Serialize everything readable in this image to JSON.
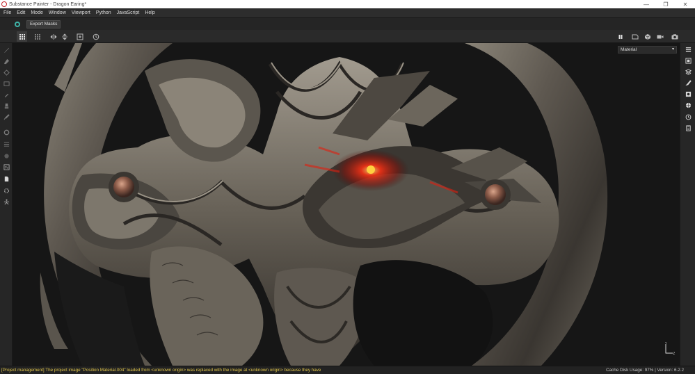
{
  "window": {
    "title": "Substance Painter - Dragon Earing*",
    "controls": [
      "minimize",
      "restore",
      "close"
    ]
  },
  "menu": [
    "File",
    "Edit",
    "Mode",
    "Window",
    "Viewport",
    "Python",
    "JavaScript",
    "Help"
  ],
  "shelf": {
    "plugin_icon": "export-masks-plugin-icon",
    "export_button_label": "Export Masks"
  },
  "toolbar": {
    "left_icons": [
      "grid-icon",
      "grid-dots-icon",
      "symmetry-x-icon",
      "symmetry-y-icon",
      "add-frame-icon",
      "history-icon"
    ],
    "right_icons": [
      "pause-icon",
      "camera-frame-icon",
      "cube-icon",
      "video-icon",
      "screenshot-icon"
    ]
  },
  "left_tools": [
    "paint-brush-icon",
    "eraser-icon",
    "projection-icon",
    "geometry-mask-icon",
    "smudge-icon",
    "clone-icon",
    "picker-icon",
    "bake-icon",
    "polygon-fill-icon",
    "material-picker-icon",
    "ps-export-icon",
    "document-icon",
    "settings-icon",
    "figure-icon"
  ],
  "viewport": {
    "display_mode": "Material",
    "gizmo_axes": [
      "Y",
      "Z"
    ]
  },
  "right_panel": [
    "layers-panel-icon",
    "texture-set-icon",
    "stack-icon",
    "brush-settings-icon",
    "display-icon",
    "globe-icon",
    "history-icon",
    "log-icon"
  ],
  "status": {
    "message": "[Project management] The project image \"Position Material.004\" loaded from <unknown origin> was replaced with the image at <unknown origin> because they have the sa...",
    "cache_label": "Cache Disk Usage:",
    "cache_value": "97%",
    "version_label": "Version: 6.2.2"
  },
  "colors": {
    "accent_teal": "#3fb4a8",
    "status_warning": "#e0c54a",
    "dragon_eye": "#ff2a10"
  }
}
